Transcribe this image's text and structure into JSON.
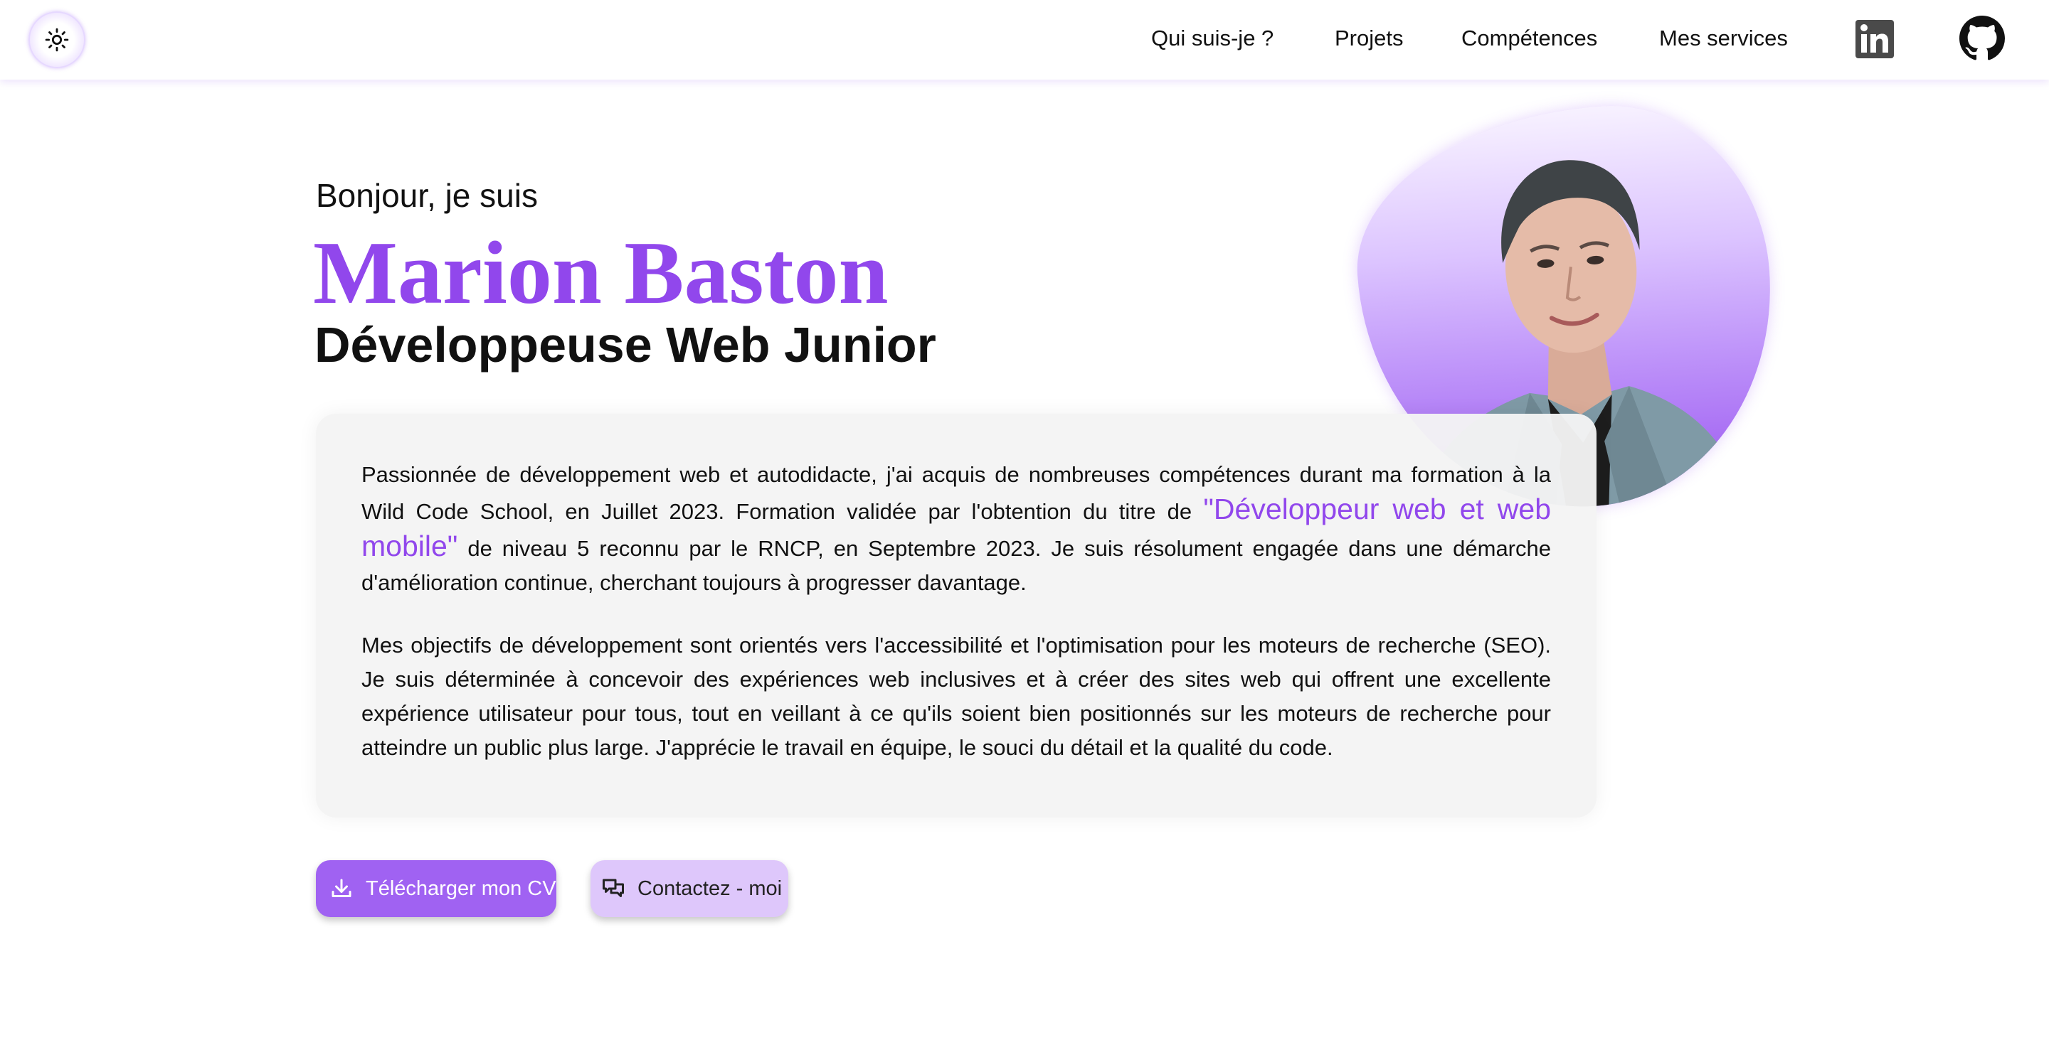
{
  "navbar": {
    "theme_toggle_icon": "sun-icon",
    "links": [
      {
        "label": "Qui suis-je ?"
      },
      {
        "label": "Projets"
      },
      {
        "label": "Compétences"
      },
      {
        "label": "Mes services"
      }
    ],
    "social_icons": [
      "linkedin-icon",
      "github-icon"
    ]
  },
  "hero": {
    "greeting": "Bonjour, je suis",
    "name": "Marion Baston",
    "job_title": "Développeuse Web Junior"
  },
  "about": {
    "para1_start": "Passionnée de développement web et autodidacte, j'ai acquis de nombreuses compétences durant ma formation à la Wild Code School, en Juillet 2023. Formation validée par l'obtention du titre de ",
    "para1_highlight": "\"Développeur web et web mobile\"",
    "para1_end": " de niveau 5 reconnu par le RNCP, en Septembre 2023. Je suis résolument engagée dans une démarche d'amélioration continue, cherchant toujours à progresser davantage.",
    "para2": "Mes objectifs de développement sont orientés vers l'accessibilité et l'optimisation pour les moteurs de recherche (SEO). Je suis déterminée à concevoir des expériences web inclusives et à créer des sites web qui offrent une excellente expérience utilisateur pour tous, tout en veillant à ce qu'ils soient bien positionnés sur les moteurs de recherche pour atteindre un public plus large. J'apprécie le travail en équipe, le souci du détail et la qualité du code."
  },
  "actions": {
    "download_cv": "Télécharger mon CV",
    "contact": "Contactez - moi"
  },
  "colors": {
    "accent": "#9147ec",
    "button_primary": "#a062f2",
    "button_secondary": "#dec7fb",
    "card_background": "#f4f4f4"
  }
}
